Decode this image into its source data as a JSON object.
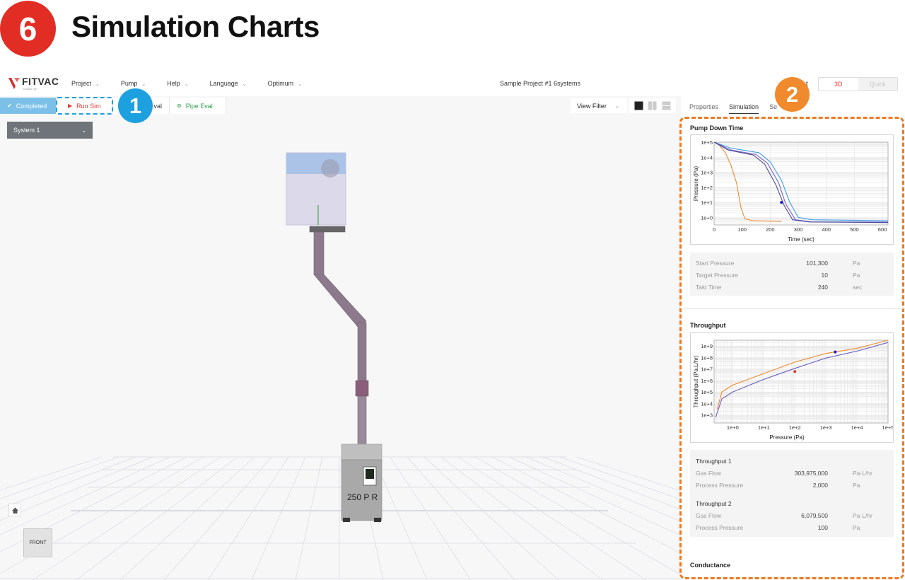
{
  "header": {
    "step_number": "6",
    "title": "Simulation Charts"
  },
  "app": {
    "logo_text": "FITVAC",
    "logo_sub": "Solution by ···",
    "menu": [
      {
        "label": "Project"
      },
      {
        "label": "Pump"
      },
      {
        "label": "Help"
      },
      {
        "label": "Language"
      },
      {
        "label": "Optimum"
      }
    ],
    "project_name": "Sample Project #1 6systems",
    "mode": {
      "active": "3D",
      "inactive": "Quick"
    },
    "partial_button": "t"
  },
  "toolbar": {
    "completed": "Completed",
    "run_sim": "Run Sim",
    "pump_eval_partial": "val",
    "pipe_eval": "Pipe Eval",
    "view_filter": "View Filter"
  },
  "viewport": {
    "system": "System 1",
    "pump_label": "250 P R",
    "front_label": "FRONT"
  },
  "callouts": {
    "one": "1",
    "two": "2"
  },
  "side": {
    "tabs": [
      "Properties",
      "Simulation",
      "Se"
    ],
    "active_tab": "Simulation",
    "pump_down": {
      "title": "Pump Down Time",
      "info": [
        {
          "label": "Start Pressure",
          "value": "101,300",
          "unit": "Pa"
        },
        {
          "label": "Target Pressure",
          "value": "10",
          "unit": "Pa"
        },
        {
          "label": "Takt Time",
          "value": "240",
          "unit": "sec"
        }
      ]
    },
    "throughput": {
      "title": "Throughput",
      "group1": {
        "title": "Throughput 1",
        "rows": [
          {
            "label": "Gas Flow",
            "value": "303,975,000",
            "unit": "Pa·L/hr"
          },
          {
            "label": "Process Pressure",
            "value": "2,000",
            "unit": "Pa"
          }
        ]
      },
      "group2": {
        "title": "Throughput 2",
        "rows": [
          {
            "label": "Gas Flow",
            "value": "6,079,500",
            "unit": "Pa·L/hr"
          },
          {
            "label": "Process Pressure",
            "value": "100",
            "unit": "Pa"
          }
        ]
      }
    },
    "conductance": {
      "title": "Conductance"
    }
  },
  "chart_data": [
    {
      "type": "line",
      "title": "",
      "xlabel": "Time (sec)",
      "ylabel": "Pressure (Pa)",
      "xlim": [
        0,
        620
      ],
      "ylim_log10": [
        -0.5,
        5
      ],
      "y_scale": "log",
      "grid": true,
      "x_ticks": [
        0,
        100,
        200,
        300,
        400,
        500,
        600
      ],
      "y_ticks": [
        "1e+5",
        "1e+4",
        "1e+3",
        "1e+2",
        "1e+1",
        "1e+0"
      ],
      "series": [
        {
          "color": "#f08a2c",
          "points": [
            [
              0,
              101300
            ],
            [
              20,
              60000
            ],
            [
              40,
              20000
            ],
            [
              60,
              3000
            ],
            [
              80,
              200
            ],
            [
              95,
              5
            ],
            [
              110,
              0.8
            ],
            [
              140,
              0.6
            ],
            [
              240,
              0.55
            ]
          ]
        },
        {
          "color": "#3c9fe6",
          "points": [
            [
              0,
              101300
            ],
            [
              60,
              40000
            ],
            [
              160,
              20000
            ],
            [
              200,
              5000
            ],
            [
              240,
              300
            ],
            [
              270,
              10
            ],
            [
              300,
              1
            ],
            [
              350,
              0.7
            ],
            [
              620,
              0.6
            ]
          ]
        },
        {
          "color": "#7b63c6",
          "points": [
            [
              0,
              101300
            ],
            [
              60,
              30000
            ],
            [
              150,
              15000
            ],
            [
              190,
              4000
            ],
            [
              230,
              200
            ],
            [
              255,
              8
            ],
            [
              290,
              0.7
            ],
            [
              350,
              0.5
            ],
            [
              620,
              0.5
            ]
          ]
        },
        {
          "color": "#4a4a9a",
          "points": [
            [
              0,
              101300
            ],
            [
              50,
              30000
            ],
            [
              140,
              14000
            ],
            [
              180,
              3500
            ],
            [
              220,
              150
            ],
            [
              250,
              6
            ],
            [
              280,
              0.7
            ],
            [
              340,
              0.5
            ],
            [
              620,
              0.45
            ]
          ]
        }
      ],
      "markers": [
        {
          "x": 240,
          "y": 10,
          "color": "#1a1acc"
        }
      ]
    },
    {
      "type": "line",
      "title": "",
      "xlabel": "Pressure (Pa)",
      "ylabel": "Throughput (Pa.L/hr)",
      "x_scale": "log",
      "y_scale": "log",
      "xlim_log10": [
        -0.6,
        5
      ],
      "ylim_log10": [
        2.3,
        9.5
      ],
      "grid": true,
      "x_ticks": [
        "1e+0",
        "1e+1",
        "1e+2",
        "1e+3",
        "1e+4",
        "1e+5"
      ],
      "y_ticks": [
        "1e+9",
        "1e+8",
        "1e+7",
        "1e+6",
        "1e+5",
        "1e+4",
        "1e+3"
      ],
      "series": [
        {
          "color": "#f08a2c",
          "points": [
            [
              -0.5,
              3.5
            ],
            [
              -0.35,
              5.0
            ],
            [
              0,
              5.6
            ],
            [
              1,
              6.6
            ],
            [
              2,
              7.6
            ],
            [
              3,
              8.35
            ],
            [
              4,
              8.8
            ],
            [
              5,
              9.5
            ]
          ]
        },
        {
          "color": "#6a5fbf",
          "points": [
            [
              -0.55,
              2.8
            ],
            [
              -0.35,
              4.4
            ],
            [
              0,
              5.0
            ],
            [
              1,
              6.1
            ],
            [
              2,
              7.05
            ],
            [
              3,
              7.95
            ],
            [
              4,
              8.55
            ],
            [
              5,
              9.3
            ]
          ]
        }
      ],
      "markers": [
        {
          "x": 3.3,
          "y": 8.48,
          "color": "#1a1acc"
        },
        {
          "x": 2.0,
          "y": 6.78,
          "color": "#e53935"
        }
      ]
    }
  ]
}
